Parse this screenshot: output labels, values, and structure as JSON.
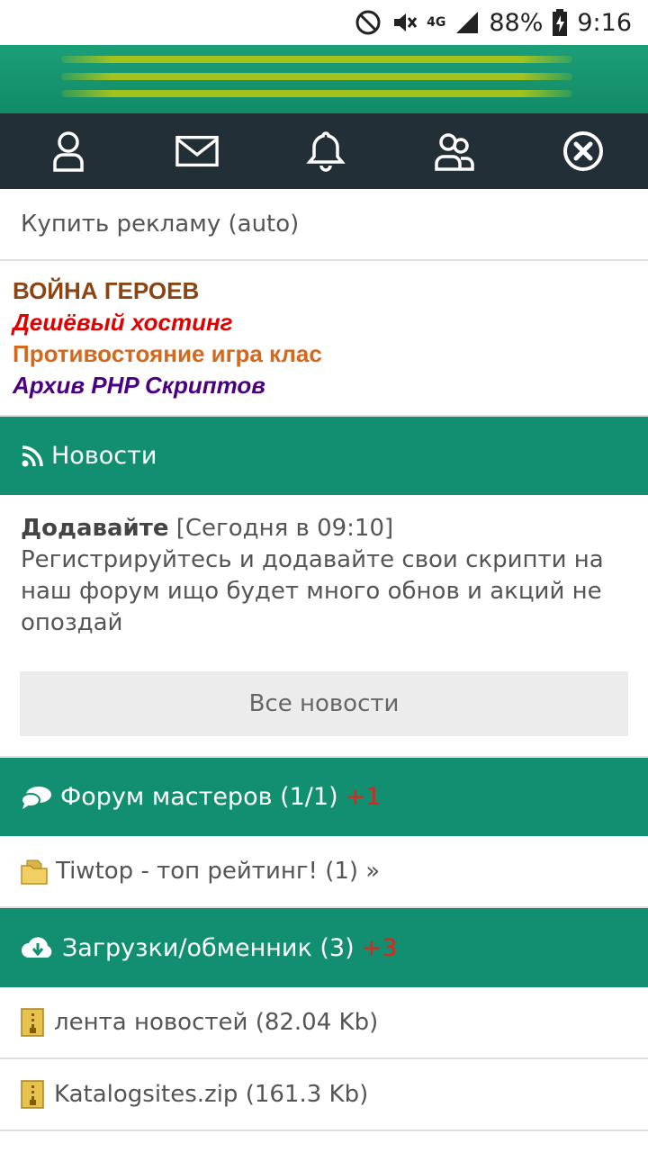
{
  "status_bar": {
    "network": "4G",
    "battery": "88%",
    "time": "9:16",
    "icons": [
      "do-not-disturb-icon",
      "mute-icon",
      "signal-icon",
      "battery-charging-icon"
    ]
  },
  "nav": {
    "icons": [
      "user-icon",
      "mail-icon",
      "bell-icon",
      "users-icon",
      "close-circle-icon"
    ]
  },
  "ad": {
    "label": "Купить рекламу (auto)"
  },
  "promo_links": [
    {
      "text": "ВОЙНА ГЕРОЕВ",
      "color": "#8b4513"
    },
    {
      "text": "Дешёвый хостинг",
      "color": "#e00000"
    },
    {
      "text": "Противостояние игра клас",
      "color": "#d2691e"
    },
    {
      "text": "Архив PHP Скриптов",
      "color": "#4b0082"
    }
  ],
  "news_section": {
    "title": "Новости",
    "icon": "rss-icon",
    "item": {
      "title": "Додавайте",
      "date": "[Сегодня в 09:10]",
      "text": "Регистрируйтесь и додавайте свои скрипти на наш форум ищо будет много обнов и акций не опоздай"
    },
    "all_button": "Все новости"
  },
  "forum_section": {
    "title": "Форум мастеров (1/1)",
    "badge": "+1",
    "icon": "chat-bubbles-icon",
    "items": [
      {
        "label": "Tiwtop - топ рейтинг! (1) »",
        "icon": "folder-icon"
      }
    ]
  },
  "downloads_section": {
    "title": "Загрузки/обменник (3)",
    "badge": "+3",
    "icon": "cloud-download-icon",
    "items": [
      {
        "label": "лента новостей (82.04 Kb)",
        "icon": "archive-icon"
      },
      {
        "label": "Katalogsites.zip (161.3 Kb)",
        "icon": "archive-icon"
      }
    ]
  },
  "colors": {
    "header_green": "#128f70",
    "nav_dark": "#232f36",
    "logo_lines": "#a4c21d",
    "badge_red": "#e0241b"
  }
}
